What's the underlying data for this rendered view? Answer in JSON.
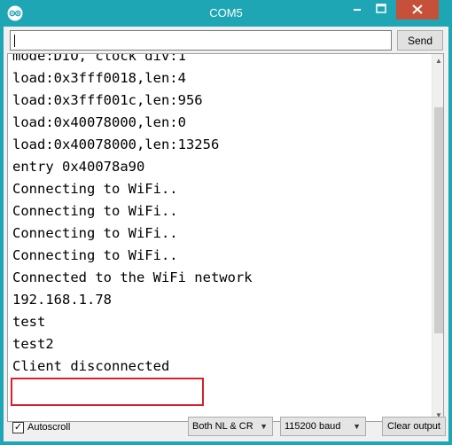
{
  "window": {
    "title": "COM5"
  },
  "toolbar": {
    "send_label": "Send",
    "send_input_value": ""
  },
  "output": {
    "lines": [
      "mode:DIO, clock div:1",
      "load:0x3fff0018,len:4",
      "load:0x3fff001c,len:956",
      "load:0x40078000,len:0",
      "load:0x40078000,len:13256",
      "entry 0x40078a90",
      "Connecting to WiFi..",
      "Connecting to WiFi..",
      "Connecting to WiFi..",
      "Connecting to WiFi..",
      "Connected to the WiFi network",
      "192.168.1.78",
      "test",
      "test2",
      "Client disconnected"
    ],
    "highlighted_line_index": 14,
    "scroll_position": 0.35
  },
  "footer": {
    "autoscroll_label": "Autoscroll",
    "autoscroll_checked": true,
    "line_ending_selected": "Both NL & CR",
    "baud_selected": "115200 baud",
    "clear_label": "Clear output"
  },
  "colors": {
    "titlebar": "#1ea6b5",
    "close_button": "#c7503a",
    "highlight": "#d6202a"
  },
  "icons": {
    "app": "arduino-icon",
    "minimize": "minimize-icon",
    "maximize": "maximize-icon",
    "close": "close-icon"
  }
}
